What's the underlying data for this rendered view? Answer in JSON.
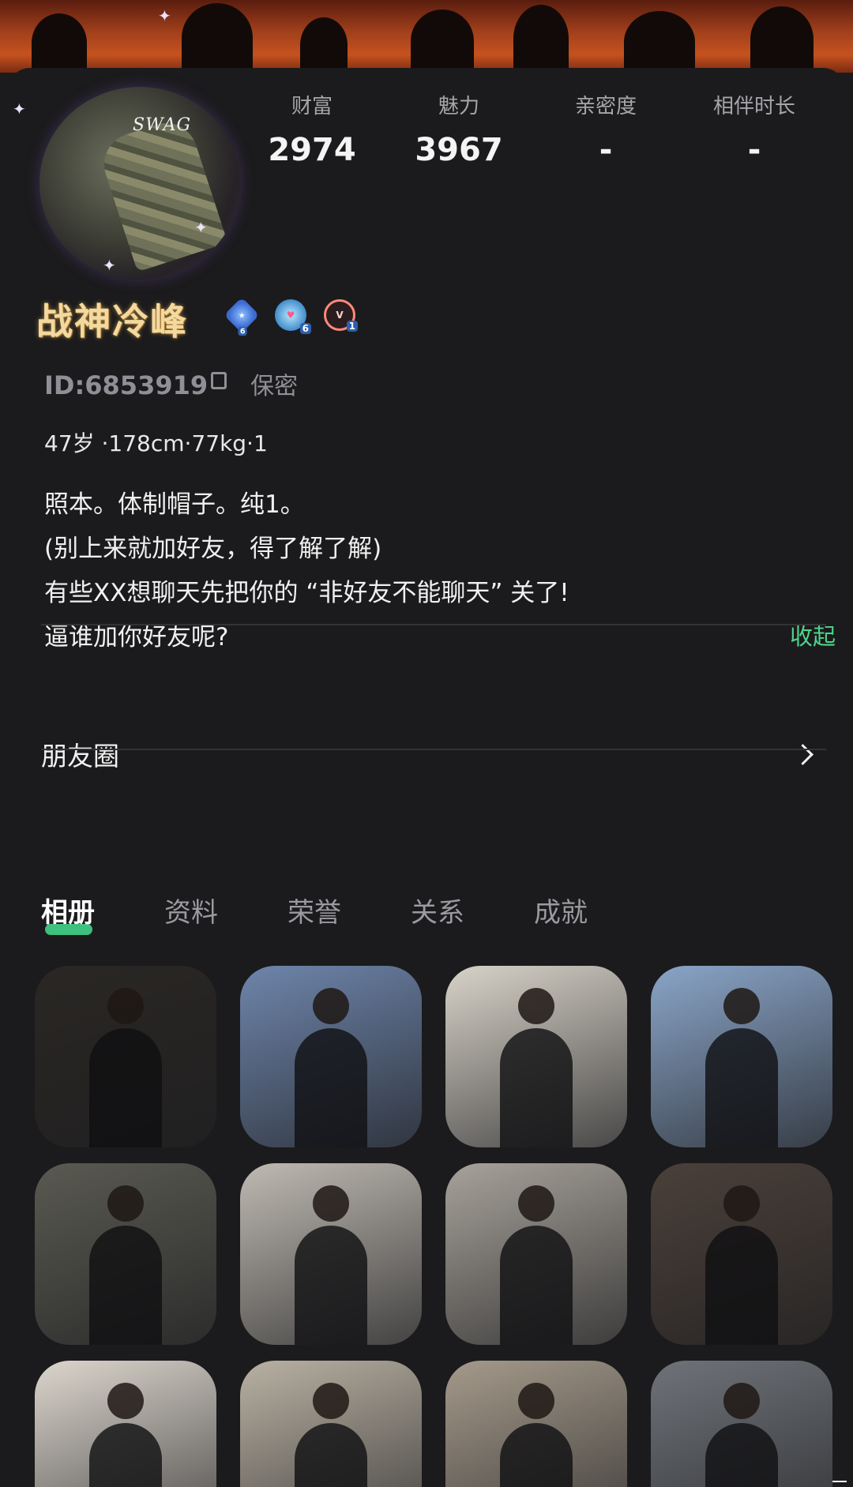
{
  "profile": {
    "username": "战神冷峰",
    "avatar_text": "SWAG",
    "id_label": "ID:6853919",
    "privacy": "保密",
    "meta": "47岁 ·178cm·77kg·1",
    "bio_lines": [
      "照本。体制帽子。纯1。",
      "(别上来就加好友，得了解了解)",
      "有些XX想聊天先把你的 “非好友不能聊天” 关了!",
      "逼谁加你好友呢?"
    ],
    "collapse_label": "收起",
    "badges": [
      {
        "icon": "level-badge-icon",
        "sub": "6"
      },
      {
        "icon": "heart-badge-icon",
        "sub": "6"
      },
      {
        "icon": "v-badge-icon",
        "sub": "1"
      }
    ]
  },
  "stats": [
    {
      "label": "财富",
      "value": "2974"
    },
    {
      "label": "魅力",
      "value": "3967"
    },
    {
      "label": "亲密度",
      "value": "-"
    },
    {
      "label": "相伴时长",
      "value": "-"
    }
  ],
  "moments": {
    "label": "朋友圈"
  },
  "tabs": [
    {
      "label": "相册",
      "active": true
    },
    {
      "label": "资料"
    },
    {
      "label": "荣誉"
    },
    {
      "label": "关系"
    },
    {
      "label": "成就"
    }
  ],
  "photos": [
    {
      "desc": "man-black-tshirt-watch",
      "bg": "#2a2724"
    },
    {
      "desc": "man-blue-uniform-shirt",
      "bg": "#6e85ab"
    },
    {
      "desc": "man-black-polo-mirror",
      "bg": "#d8d3c9"
    },
    {
      "desc": "man-blue-uniform-phone",
      "bg": "#8aa5c8"
    },
    {
      "desc": "man-camo-pants-lying",
      "bg": "#5a5a52"
    },
    {
      "desc": "man-black-tanktop-bathroom",
      "bg": "#bfbab2"
    },
    {
      "desc": "man-black-shirt-doorway",
      "bg": "#a7a29a"
    },
    {
      "desc": "abs-closeup",
      "bg": "#4b403a"
    },
    {
      "desc": "boots-and-socks",
      "bg": "#dcd6cd"
    },
    {
      "desc": "man-police-uniform-office",
      "bg": "#b9b1a3"
    },
    {
      "desc": "camo-legs-boots",
      "bg": "#a59a8b"
    },
    {
      "desc": "man-police-outdoor",
      "bg": "#6f7379"
    }
  ]
}
